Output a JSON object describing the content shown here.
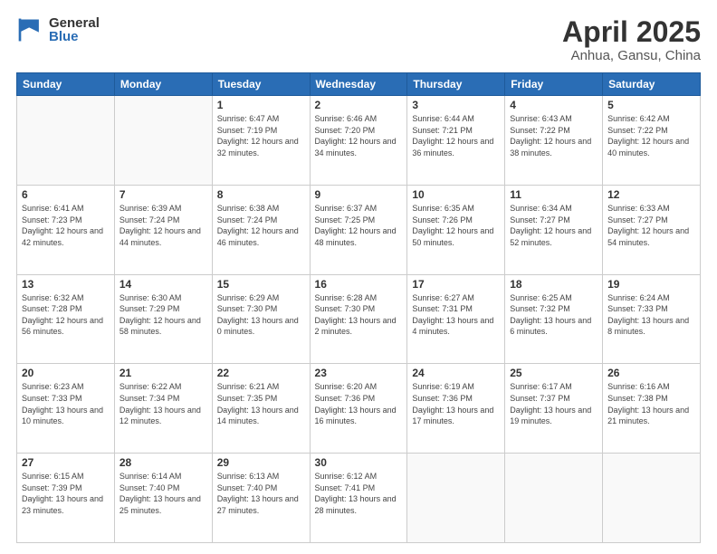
{
  "logo": {
    "general": "General",
    "blue": "Blue"
  },
  "title": {
    "month": "April 2025",
    "location": "Anhua, Gansu, China"
  },
  "weekdays": [
    "Sunday",
    "Monday",
    "Tuesday",
    "Wednesday",
    "Thursday",
    "Friday",
    "Saturday"
  ],
  "weeks": [
    [
      {
        "day": "",
        "sunrise": "",
        "sunset": "",
        "daylight": ""
      },
      {
        "day": "",
        "sunrise": "",
        "sunset": "",
        "daylight": ""
      },
      {
        "day": "1",
        "sunrise": "Sunrise: 6:47 AM",
        "sunset": "Sunset: 7:19 PM",
        "daylight": "Daylight: 12 hours and 32 minutes."
      },
      {
        "day": "2",
        "sunrise": "Sunrise: 6:46 AM",
        "sunset": "Sunset: 7:20 PM",
        "daylight": "Daylight: 12 hours and 34 minutes."
      },
      {
        "day": "3",
        "sunrise": "Sunrise: 6:44 AM",
        "sunset": "Sunset: 7:21 PM",
        "daylight": "Daylight: 12 hours and 36 minutes."
      },
      {
        "day": "4",
        "sunrise": "Sunrise: 6:43 AM",
        "sunset": "Sunset: 7:22 PM",
        "daylight": "Daylight: 12 hours and 38 minutes."
      },
      {
        "day": "5",
        "sunrise": "Sunrise: 6:42 AM",
        "sunset": "Sunset: 7:22 PM",
        "daylight": "Daylight: 12 hours and 40 minutes."
      }
    ],
    [
      {
        "day": "6",
        "sunrise": "Sunrise: 6:41 AM",
        "sunset": "Sunset: 7:23 PM",
        "daylight": "Daylight: 12 hours and 42 minutes."
      },
      {
        "day": "7",
        "sunrise": "Sunrise: 6:39 AM",
        "sunset": "Sunset: 7:24 PM",
        "daylight": "Daylight: 12 hours and 44 minutes."
      },
      {
        "day": "8",
        "sunrise": "Sunrise: 6:38 AM",
        "sunset": "Sunset: 7:24 PM",
        "daylight": "Daylight: 12 hours and 46 minutes."
      },
      {
        "day": "9",
        "sunrise": "Sunrise: 6:37 AM",
        "sunset": "Sunset: 7:25 PM",
        "daylight": "Daylight: 12 hours and 48 minutes."
      },
      {
        "day": "10",
        "sunrise": "Sunrise: 6:35 AM",
        "sunset": "Sunset: 7:26 PM",
        "daylight": "Daylight: 12 hours and 50 minutes."
      },
      {
        "day": "11",
        "sunrise": "Sunrise: 6:34 AM",
        "sunset": "Sunset: 7:27 PM",
        "daylight": "Daylight: 12 hours and 52 minutes."
      },
      {
        "day": "12",
        "sunrise": "Sunrise: 6:33 AM",
        "sunset": "Sunset: 7:27 PM",
        "daylight": "Daylight: 12 hours and 54 minutes."
      }
    ],
    [
      {
        "day": "13",
        "sunrise": "Sunrise: 6:32 AM",
        "sunset": "Sunset: 7:28 PM",
        "daylight": "Daylight: 12 hours and 56 minutes."
      },
      {
        "day": "14",
        "sunrise": "Sunrise: 6:30 AM",
        "sunset": "Sunset: 7:29 PM",
        "daylight": "Daylight: 12 hours and 58 minutes."
      },
      {
        "day": "15",
        "sunrise": "Sunrise: 6:29 AM",
        "sunset": "Sunset: 7:30 PM",
        "daylight": "Daylight: 13 hours and 0 minutes."
      },
      {
        "day": "16",
        "sunrise": "Sunrise: 6:28 AM",
        "sunset": "Sunset: 7:30 PM",
        "daylight": "Daylight: 13 hours and 2 minutes."
      },
      {
        "day": "17",
        "sunrise": "Sunrise: 6:27 AM",
        "sunset": "Sunset: 7:31 PM",
        "daylight": "Daylight: 13 hours and 4 minutes."
      },
      {
        "day": "18",
        "sunrise": "Sunrise: 6:25 AM",
        "sunset": "Sunset: 7:32 PM",
        "daylight": "Daylight: 13 hours and 6 minutes."
      },
      {
        "day": "19",
        "sunrise": "Sunrise: 6:24 AM",
        "sunset": "Sunset: 7:33 PM",
        "daylight": "Daylight: 13 hours and 8 minutes."
      }
    ],
    [
      {
        "day": "20",
        "sunrise": "Sunrise: 6:23 AM",
        "sunset": "Sunset: 7:33 PM",
        "daylight": "Daylight: 13 hours and 10 minutes."
      },
      {
        "day": "21",
        "sunrise": "Sunrise: 6:22 AM",
        "sunset": "Sunset: 7:34 PM",
        "daylight": "Daylight: 13 hours and 12 minutes."
      },
      {
        "day": "22",
        "sunrise": "Sunrise: 6:21 AM",
        "sunset": "Sunset: 7:35 PM",
        "daylight": "Daylight: 13 hours and 14 minutes."
      },
      {
        "day": "23",
        "sunrise": "Sunrise: 6:20 AM",
        "sunset": "Sunset: 7:36 PM",
        "daylight": "Daylight: 13 hours and 16 minutes."
      },
      {
        "day": "24",
        "sunrise": "Sunrise: 6:19 AM",
        "sunset": "Sunset: 7:36 PM",
        "daylight": "Daylight: 13 hours and 17 minutes."
      },
      {
        "day": "25",
        "sunrise": "Sunrise: 6:17 AM",
        "sunset": "Sunset: 7:37 PM",
        "daylight": "Daylight: 13 hours and 19 minutes."
      },
      {
        "day": "26",
        "sunrise": "Sunrise: 6:16 AM",
        "sunset": "Sunset: 7:38 PM",
        "daylight": "Daylight: 13 hours and 21 minutes."
      }
    ],
    [
      {
        "day": "27",
        "sunrise": "Sunrise: 6:15 AM",
        "sunset": "Sunset: 7:39 PM",
        "daylight": "Daylight: 13 hours and 23 minutes."
      },
      {
        "day": "28",
        "sunrise": "Sunrise: 6:14 AM",
        "sunset": "Sunset: 7:40 PM",
        "daylight": "Daylight: 13 hours and 25 minutes."
      },
      {
        "day": "29",
        "sunrise": "Sunrise: 6:13 AM",
        "sunset": "Sunset: 7:40 PM",
        "daylight": "Daylight: 13 hours and 27 minutes."
      },
      {
        "day": "30",
        "sunrise": "Sunrise: 6:12 AM",
        "sunset": "Sunset: 7:41 PM",
        "daylight": "Daylight: 13 hours and 28 minutes."
      },
      {
        "day": "",
        "sunrise": "",
        "sunset": "",
        "daylight": ""
      },
      {
        "day": "",
        "sunrise": "",
        "sunset": "",
        "daylight": ""
      },
      {
        "day": "",
        "sunrise": "",
        "sunset": "",
        "daylight": ""
      }
    ]
  ]
}
